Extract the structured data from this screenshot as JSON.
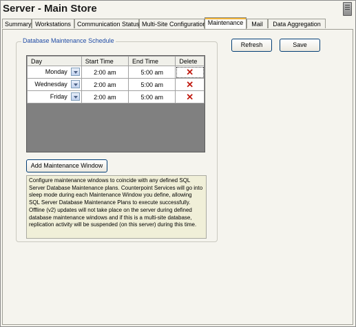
{
  "window": {
    "title": "Server - Main Store"
  },
  "tabs": [
    {
      "label": "Summary",
      "active": false
    },
    {
      "label": "Workstations",
      "active": false
    },
    {
      "label": "Communication Status",
      "active": false
    },
    {
      "label": "Multi-Site Configuration",
      "active": false
    },
    {
      "label": "Maintenance",
      "active": true
    },
    {
      "label": "Mail",
      "active": false
    },
    {
      "label": "Data Aggregation",
      "active": false
    }
  ],
  "schedule": {
    "group_title": "Database Maintenance Schedule",
    "columns": [
      "Day",
      "Start Time",
      "End Time",
      "Delete"
    ],
    "rows": [
      {
        "day": "Monday",
        "start": "2:00 am",
        "end": "5:00 am"
      },
      {
        "day": "Wednesday",
        "start": "2:00 am",
        "end": "5:00 am"
      },
      {
        "day": "Friday",
        "start": "2:00 am",
        "end": "5:00 am"
      }
    ],
    "add_button": "Add Maintenance Window",
    "info_text": "Configure maintenance windows to coincide with any defined SQL Server Database Maintenance plans.  Counterpoint Services will go into sleep mode during each Maintenance Window you define, allowing SQL Server Database Maintenance Plans to execute successfully. Offline (v2) updates will not take place on the server during defined database maintenance windows and if this is a multi-site database, replication activity will be suspended (on this server) during this time."
  },
  "toolbar": {
    "refresh_label": "Refresh",
    "save_label": "Save"
  },
  "icons": {
    "delete": "delete-x-icon",
    "dropdown": "chevron-down-icon",
    "server": "server-icon"
  },
  "colors": {
    "accent_tab": "#f0b43c",
    "group_title": "#1f4ba5",
    "delete_icon": "#c0190f",
    "grid_background": "#808080",
    "info_background": "#f0efd8"
  }
}
